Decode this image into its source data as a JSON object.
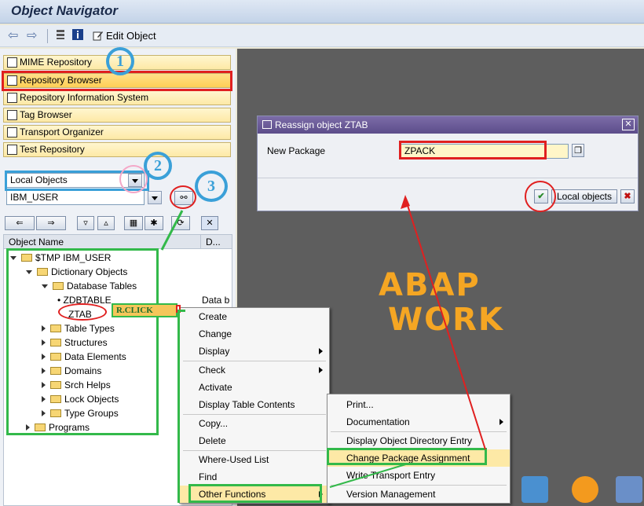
{
  "app": {
    "title": "Object Navigator"
  },
  "toolbar": {
    "edit_object_label": "Edit Object"
  },
  "nav_buttons": [
    {
      "label": "MIME Repository"
    },
    {
      "label": "Repository Browser"
    },
    {
      "label": "Repository Information System"
    },
    {
      "label": "Tag Browser"
    },
    {
      "label": "Transport Organizer"
    },
    {
      "label": "Test Repository"
    }
  ],
  "browser": {
    "object_type_value": "Local Objects",
    "user_value": "IBM_USER"
  },
  "tree": {
    "col_object_name": "Object Name",
    "col_description": "D...",
    "rows": [
      {
        "label": "$TMP IBM_USER"
      },
      {
        "label": "Dictionary Objects"
      },
      {
        "label": "Database Tables"
      },
      {
        "label": "ZDBTABLE",
        "desc": "Data b"
      },
      {
        "label": "ZTAB"
      },
      {
        "label": "Table Types"
      },
      {
        "label": "Structures"
      },
      {
        "label": "Data Elements"
      },
      {
        "label": "Domains"
      },
      {
        "label": "Srch Helps"
      },
      {
        "label": "Lock Objects"
      },
      {
        "label": "Type Groups"
      },
      {
        "label": "Programs"
      }
    ]
  },
  "annotations": {
    "step1": "1",
    "step2": "2",
    "step3": "3",
    "rclick": "R.CLICK",
    "watermark_line1": "ABAP",
    "watermark_line2": "WORK"
  },
  "dialog": {
    "title": "Reassign object ZTAB",
    "new_package_label": "New Package",
    "new_package_value": "ZPACK",
    "local_objects_button": "Local objects"
  },
  "context_menu": {
    "items": [
      "Create",
      "Change",
      "Display",
      "Check",
      "Activate",
      "Display Table Contents",
      "Copy...",
      "Delete",
      "Where-Used List",
      "Find",
      "Other Functions"
    ]
  },
  "submenu": {
    "items": [
      "Print...",
      "Documentation",
      "Display Object Directory Entry",
      "Change Package Assignment",
      "Write Transport Entry",
      "Version Management"
    ]
  },
  "colors": {
    "accent_red": "#e02020",
    "annotation_blue": "#3aa0d8",
    "annotation_green": "#33b94a",
    "watermark": "#f5a623"
  }
}
